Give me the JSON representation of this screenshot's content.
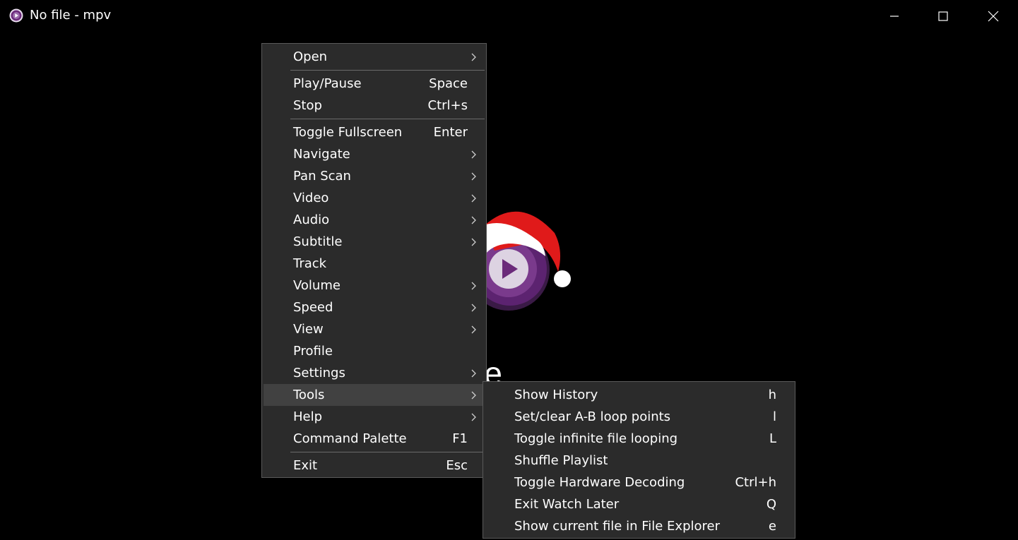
{
  "window": {
    "title": "No file - mpv",
    "icons": {
      "app": "mpv-logo-icon",
      "minimize": "minimize-icon",
      "maximize": "maximize-icon",
      "close": "close-icon"
    }
  },
  "canvas": {
    "drop_text": "RLs to play here."
  },
  "menu": {
    "groups": [
      [
        {
          "label": "Open",
          "submenu": true
        }
      ],
      [
        {
          "label": "Play/Pause",
          "shortcut": "Space"
        },
        {
          "label": "Stop",
          "shortcut": "Ctrl+s"
        }
      ],
      [
        {
          "label": "Toggle Fullscreen",
          "shortcut": "Enter"
        },
        {
          "label": "Navigate",
          "submenu": true
        },
        {
          "label": "Pan  Scan",
          "submenu": true
        },
        {
          "label": "Video",
          "submenu": true
        },
        {
          "label": "Audio",
          "submenu": true
        },
        {
          "label": "Subtitle",
          "submenu": true
        },
        {
          "label": "Track"
        },
        {
          "label": "Volume",
          "submenu": true
        },
        {
          "label": "Speed",
          "submenu": true
        },
        {
          "label": "View",
          "submenu": true
        },
        {
          "label": "Profile"
        },
        {
          "label": "Settings",
          "submenu": true
        },
        {
          "label": "Tools",
          "submenu": true,
          "active": true
        },
        {
          "label": "Help",
          "submenu": true
        },
        {
          "label": "Command Palette",
          "shortcut": "F1"
        }
      ],
      [
        {
          "label": "Exit",
          "shortcut": "Esc"
        }
      ]
    ]
  },
  "tools_submenu": [
    {
      "label": "Show History",
      "shortcut": "h"
    },
    {
      "label": "Set/clear A-B loop points",
      "shortcut": "l"
    },
    {
      "label": "Toggle infinite file looping",
      "shortcut": "L"
    },
    {
      "label": "Shuffle Playlist",
      "shortcut": ""
    },
    {
      "label": "Toggle Hardware Decoding",
      "shortcut": "Ctrl+h"
    },
    {
      "label": "Exit Watch Later",
      "shortcut": "Q"
    },
    {
      "label": "Show current file in File Explorer",
      "shortcut": "e"
    }
  ],
  "colors": {
    "menu_bg": "#2b2b2b",
    "menu_active": "#414141",
    "menu_border": "#5a5a5a",
    "logo_purple": "#6b2a7a",
    "santa_red": "#e01a1a"
  }
}
